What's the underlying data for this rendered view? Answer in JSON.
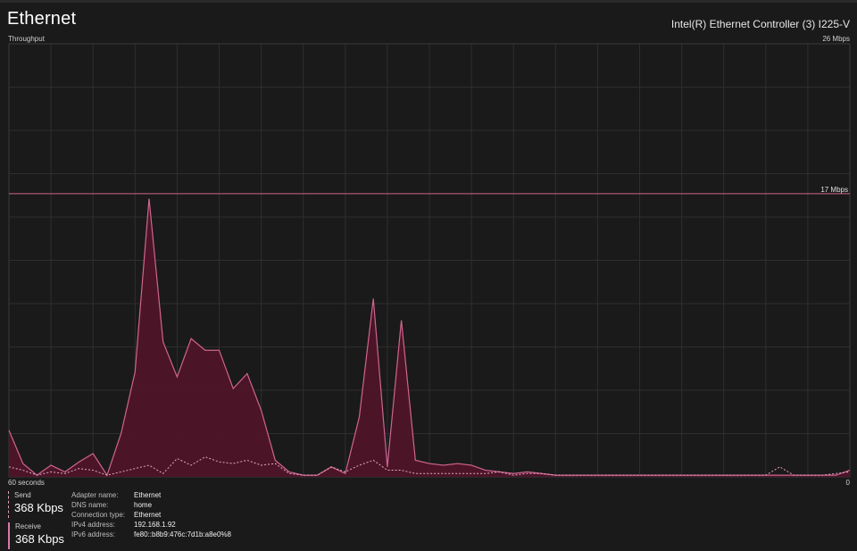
{
  "header": {
    "title": "Ethernet",
    "adapter": "Intel(R) Ethernet Controller (3) I225-V"
  },
  "chart": {
    "throughput_label": "Throughput",
    "max_label": "26 Mbps",
    "ref_label": "17 Mbps",
    "x_start_label": "60 seconds",
    "x_end_label": "0",
    "colors": {
      "receive_line": "#d0648f",
      "receive_fill": "#4f1528",
      "send_line": "#e8a6c4",
      "grid": "#2e2e2e",
      "border": "#3a3a3a",
      "ref_line": "#d0648f"
    }
  },
  "chart_data": {
    "type": "area",
    "x_range": [
      60,
      0
    ],
    "y_range_mbps": [
      0,
      26
    ],
    "reference_line_mbps": 17,
    "grid": true,
    "series": [
      {
        "name": "Receive",
        "x": [
          60,
          59,
          58,
          57,
          56,
          55,
          54,
          53,
          52,
          51,
          50,
          49,
          48,
          47,
          46,
          45,
          44,
          43,
          42,
          41,
          40,
          39,
          38,
          37,
          36,
          35,
          34,
          33,
          32,
          31,
          30,
          29,
          28,
          27,
          26,
          25,
          24,
          23,
          22,
          21,
          20,
          19,
          18,
          17,
          16,
          15,
          14,
          13,
          12,
          11,
          10,
          9,
          8,
          7,
          6,
          5,
          4,
          3,
          2,
          1,
          0
        ],
        "values": [
          2.8,
          0.8,
          0.1,
          0.7,
          0.3,
          0.9,
          1.4,
          0.1,
          2.6,
          6.3,
          16.7,
          8.1,
          6.0,
          8.3,
          7.6,
          7.6,
          5.3,
          6.2,
          4.0,
          1.0,
          0.3,
          0.1,
          0.1,
          0.6,
          0.2,
          3.6,
          10.7,
          0.6,
          9.4,
          1.0,
          0.8,
          0.7,
          0.8,
          0.7,
          0.4,
          0.3,
          0.2,
          0.3,
          0.2,
          0.1,
          0.1,
          0.1,
          0.1,
          0.1,
          0.1,
          0.1,
          0.1,
          0.1,
          0.1,
          0.1,
          0.1,
          0.1,
          0.1,
          0.1,
          0.1,
          0.1,
          0.1,
          0.1,
          0.1,
          0.1,
          0.4
        ]
      },
      {
        "name": "Send",
        "x": [
          60,
          59,
          58,
          57,
          56,
          55,
          54,
          53,
          52,
          51,
          50,
          49,
          48,
          47,
          46,
          45,
          44,
          43,
          42,
          41,
          40,
          39,
          38,
          37,
          36,
          35,
          34,
          33,
          32,
          31,
          30,
          29,
          28,
          27,
          26,
          25,
          24,
          23,
          22,
          21,
          20,
          19,
          18,
          17,
          16,
          15,
          14,
          13,
          12,
          11,
          10,
          9,
          8,
          7,
          6,
          5,
          4,
          3,
          2,
          1,
          0
        ],
        "values": [
          0.6,
          0.4,
          0.1,
          0.3,
          0.2,
          0.5,
          0.4,
          0.1,
          0.3,
          0.5,
          0.7,
          0.2,
          1.1,
          0.7,
          1.2,
          0.9,
          0.8,
          1.0,
          0.7,
          0.8,
          0.2,
          0.1,
          0.1,
          0.6,
          0.3,
          0.7,
          1.0,
          0.4,
          0.4,
          0.2,
          0.2,
          0.2,
          0.2,
          0.2,
          0.2,
          0.3,
          0.1,
          0.2,
          0.2,
          0.1,
          0.1,
          0.1,
          0.1,
          0.1,
          0.1,
          0.1,
          0.1,
          0.1,
          0.1,
          0.1,
          0.1,
          0.1,
          0.1,
          0.1,
          0.1,
          0.6,
          0.1,
          0.1,
          0.1,
          0.2,
          0.3
        ]
      }
    ]
  },
  "stats": {
    "send_label": "Send",
    "send_value": "368 Kbps",
    "receive_label": "Receive",
    "receive_value": "368 Kbps"
  },
  "properties": [
    {
      "key": "Adapter name:",
      "value": "Ethernet"
    },
    {
      "key": "DNS name:",
      "value": "home"
    },
    {
      "key": "Connection type:",
      "value": "Ethernet"
    },
    {
      "key": "IPv4 address:",
      "value": "192.168.1.92"
    },
    {
      "key": "IPv6 address:",
      "value": "fe80::b8b9:476c:7d1b:a8e0%8"
    }
  ]
}
